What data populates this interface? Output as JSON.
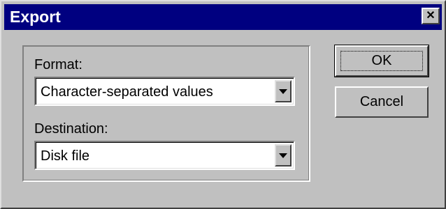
{
  "window": {
    "title": "Export",
    "close_glyph": "✕"
  },
  "form": {
    "format": {
      "label": "Format:",
      "selected": "Character-separated values"
    },
    "destination": {
      "label": "Destination:",
      "selected": "Disk file"
    }
  },
  "buttons": {
    "ok_label": "OK",
    "cancel_label": "Cancel"
  },
  "icons": {
    "close": "close-icon",
    "dropdown": "chevron-down-icon"
  },
  "colors": {
    "titlebar": "#000080",
    "face": "#c0c0c0"
  }
}
